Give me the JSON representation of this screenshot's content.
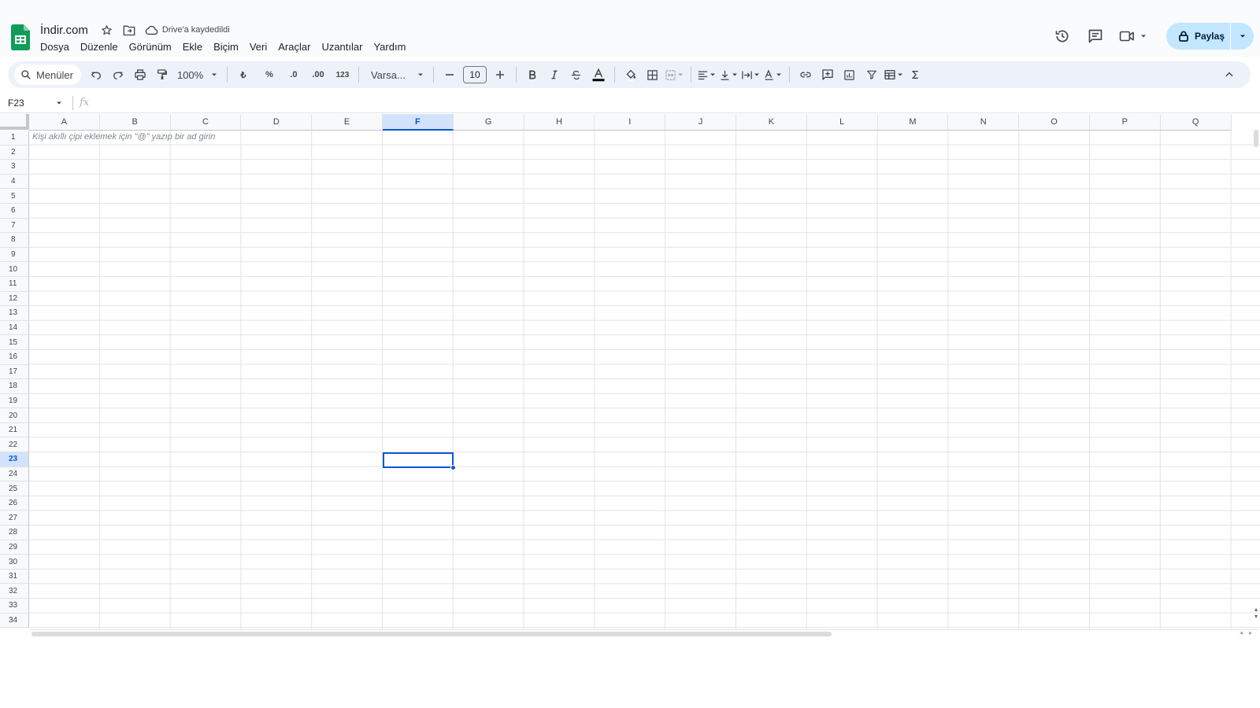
{
  "app": {
    "doc_title": "İndir.com",
    "save_status": "Drive'a kaydedildi"
  },
  "menu": [
    "Dosya",
    "Düzenle",
    "Görünüm",
    "Ekle",
    "Biçim",
    "Veri",
    "Araçlar",
    "Uzantılar",
    "Yardım"
  ],
  "share": {
    "label": "Paylaş"
  },
  "toolbar": {
    "search_label": "Menüler",
    "zoom": "100%",
    "currency": "₺",
    "percent": "%",
    "dec_decrease": ".0",
    "dec_increase": ".00",
    "number_format": "123",
    "font": "Varsa...",
    "font_size": "10"
  },
  "formula_bar": {
    "name_box": "F23",
    "fx": "fx",
    "value": ""
  },
  "grid": {
    "columns": [
      "A",
      "B",
      "C",
      "D",
      "E",
      "F",
      "G",
      "H",
      "I",
      "J",
      "K",
      "L",
      "M",
      "N",
      "O",
      "P",
      "Q"
    ],
    "selected_column": "F",
    "rows": [
      "1",
      "2",
      "3",
      "4",
      "5",
      "6",
      "7",
      "8",
      "9",
      "10",
      "11",
      "12",
      "13",
      "14",
      "15",
      "16",
      "17",
      "18",
      "19",
      "20",
      "21",
      "22",
      "23",
      "24",
      "25",
      "26",
      "27",
      "28",
      "29",
      "30",
      "31",
      "32",
      "33",
      "34"
    ],
    "selected_row": "23",
    "a1_hint": "Kişi akıllı çipi eklemek için \"@\" yazıp bir ad girin"
  },
  "colors": {
    "accent": "#0b57d0",
    "share_bg": "#c2e7ff",
    "toolbar_bg": "#edf2fa",
    "sheets_green": "#0f9d58"
  }
}
